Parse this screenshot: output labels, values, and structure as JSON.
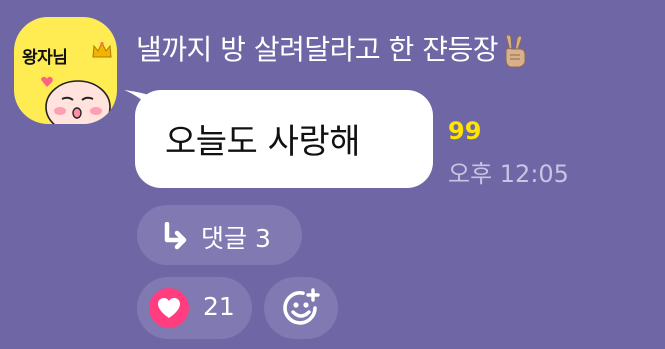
{
  "avatar": {
    "text": "왕자님",
    "icons": [
      "crown-icon",
      "peach-character-icon"
    ],
    "background": "#ffeb52"
  },
  "message": {
    "sender_name": "낼까지 방 살려달라고 한 쟌등장",
    "sender_emoji": "victory-hand-icon",
    "text": "오늘도 사랑해",
    "unread_count": "99",
    "time": "오후 12:05"
  },
  "reply": {
    "icon": "reply-arrow-icon",
    "label": "댓글 3"
  },
  "reactions": {
    "like_icon": "heart-icon",
    "like_count": "21",
    "add_icon": "add-emoji-icon"
  },
  "colors": {
    "background": "#6f67a5",
    "chip": "#8079b2",
    "unread": "#ffe500",
    "heart": "#ff3d7f",
    "bubble": "#ffffff"
  }
}
